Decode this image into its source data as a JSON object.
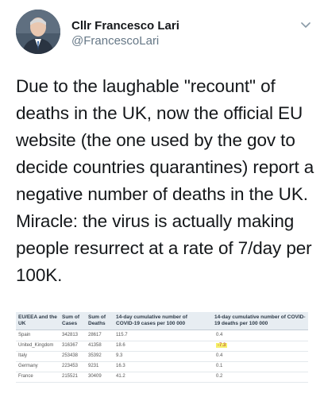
{
  "tweet": {
    "display_name": "Cllr Francesco Lari",
    "handle": "@FrancescoLari",
    "text": "Due to the laughable \"recount\" of deaths in the UK, now the official EU website (the one used by the gov to decide countries quarantines) report a negative number of deaths in the UK. Miracle: the virus is actually making people resurrect at a rate of 7/day per 100K."
  },
  "table": {
    "headers": [
      "EU/EEA and the UK",
      "Sum of Cases",
      "Sum of Deaths",
      "14-day cumulative number of COVID-19 cases per 100 000",
      "14-day cumulative number of COVID-19 deaths per 100 000"
    ],
    "rows": [
      [
        "Spain",
        "342813",
        "28617",
        "115.7",
        "0.4"
      ],
      [
        "United_Kingdom",
        "316367",
        "41358",
        "18.6",
        "-7.3"
      ],
      [
        "Italy",
        "253438",
        "35392",
        "9.3",
        "0.4"
      ],
      [
        "Germany",
        "223453",
        "9231",
        "16.3",
        "0.1"
      ],
      [
        "France",
        "215521",
        "30409",
        "41.2",
        "0.2"
      ]
    ],
    "highlight_color": "#f5ef6a"
  },
  "icons": {
    "avatar": "profile-photo",
    "menu": "chevron-down-icon"
  }
}
